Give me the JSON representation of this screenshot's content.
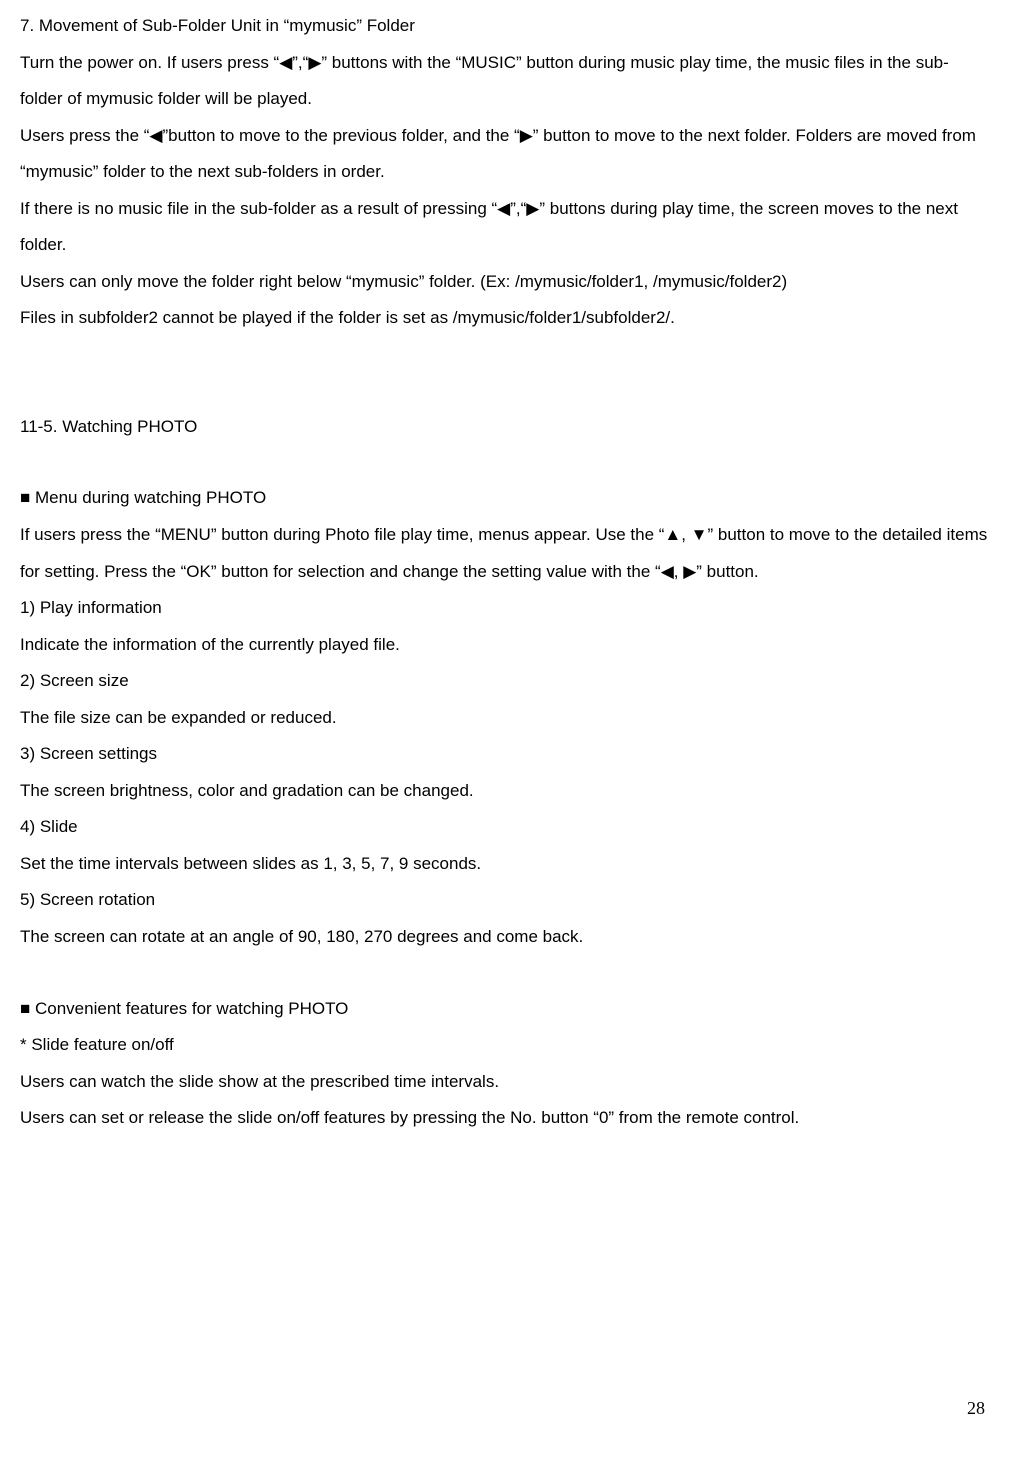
{
  "section7": {
    "title": "7. Movement of Sub-Folder Unit in “mymusic” Folder",
    "p1": "Turn the power on. If users press “◀”,“▶” buttons with the “MUSIC” button during music play time, the music files in the sub-folder of mymusic folder will be played.",
    "p2": "Users press the “◀”button to move to the previous folder, and the “▶” button to move to the next folder. Folders are moved from “mymusic” folder to the next sub-folders in order.",
    "p3": "If there is no music file in the sub-folder as a result of pressing “◀”,“▶” buttons during play time, the screen moves to the next folder.",
    "p4": "Users can only move the folder right below “mymusic” folder. (Ex: /mymusic/folder1, /mymusic/folder2)",
    "p5": "Files in subfolder2 cannot be played if the folder is set as /mymusic/folder1/subfolder2/."
  },
  "section115": {
    "title": "11-5. Watching PHOTO"
  },
  "menuPhoto": {
    "heading": "■ Menu during watching PHOTO",
    "intro": "If users press the “MENU” button during Photo file play time, menus appear. Use the “▲, ▼” button to move to the detailed items for setting. Press the “OK” button for selection and change the setting value with the “◀, ▶” button.",
    "item1_title": "1) Play information",
    "item1_desc": "Indicate the information of the currently played file.",
    "item2_title": "2) Screen size",
    "item2_desc": "The file size can be expanded or reduced.",
    "item3_title": "3) Screen settings",
    "item3_desc": "The screen brightness, color and gradation can be changed.",
    "item4_title": "4) Slide",
    "item4_desc": "Set the time intervals between slides as 1, 3, 5, 7, 9 seconds.",
    "item5_title": "5) Screen rotation",
    "item5_desc": "The screen can rotate at an angle of 90, 180, 270 degrees and come back."
  },
  "convenient": {
    "heading": "■ Convenient features for watching PHOTO",
    "sub1_title": "* Slide feature on/off",
    "sub1_p1": "Users can watch the slide show at the prescribed time intervals.",
    "sub1_p2": "Users can set or release the slide on/off features by pressing the No. button “0” from the remote control."
  },
  "pageNumber": "28"
}
